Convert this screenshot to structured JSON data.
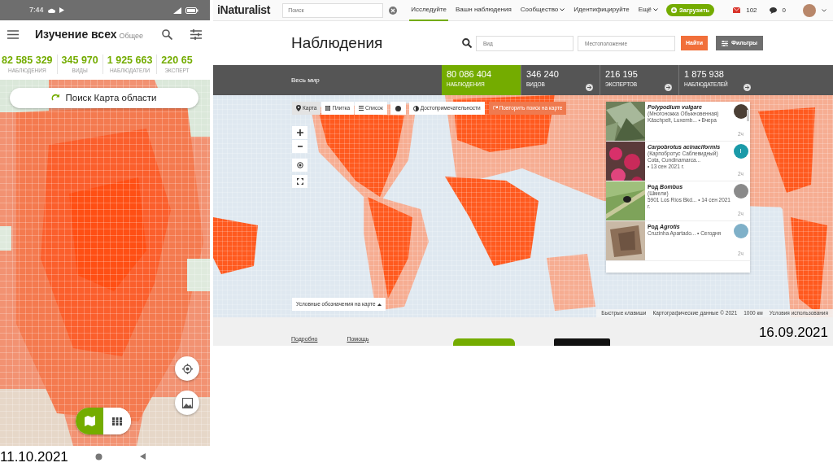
{
  "phone": {
    "status_bar": {
      "time": "7:44"
    },
    "app_bar": {
      "title": "Изучение всех",
      "subtitle": "Общее"
    },
    "stats": [
      {
        "value": "82 585 329",
        "label": "НАБЛЮДЕНИЯ"
      },
      {
        "value": "345 970",
        "label": "ВИДЫ"
      },
      {
        "value": "1 925 663",
        "label": "НАБЛЮДАТЕЛИ"
      },
      {
        "value": "220 65",
        "label": "ЭКСПЕРТ"
      }
    ],
    "search_button": "Поиск Карта области",
    "view_toggle": [
      {
        "kind": "map",
        "selected": true
      },
      {
        "kind": "grid",
        "selected": false
      }
    ],
    "caption": "11.10.2021"
  },
  "web": {
    "navbar": {
      "logo": "iNaturalist",
      "search": {
        "placeholder": "Поиск"
      },
      "links": [
        {
          "label": "Исследуйте",
          "selected": true,
          "dropdown": false
        },
        {
          "label": "Вашн наблюдения",
          "selected": false,
          "dropdown": false
        },
        {
          "label": "Сообщество",
          "selected": false,
          "dropdown": true
        },
        {
          "label": "Идентифицируйте",
          "selected": false,
          "dropdown": false
        },
        {
          "label": "Ещё",
          "selected": false,
          "dropdown": true
        }
      ],
      "upload_button": "Загрузить",
      "messages": "102",
      "notifications": "0"
    },
    "header": {
      "title": "Наблюдения",
      "taxon_field": {
        "placeholder": "Вид"
      },
      "place_field": {
        "placeholder": "Местоположение"
      },
      "search_button": "Найти",
      "filters_button": "Фильтры"
    },
    "stats_bar": {
      "place": "Весь мир",
      "stats": [
        {
          "value": "80 086 404",
          "label": "НАБЛЮДЕНИЯ",
          "selected": true
        },
        {
          "value": "346 240",
          "label": "ВИДОВ",
          "selected": false
        },
        {
          "value": "216 195",
          "label": "ЭКСПЕРТОВ",
          "selected": false
        },
        {
          "value": "1 875 938",
          "label": "НАБЛЮДАТЕЛЕЙ",
          "selected": false
        }
      ]
    },
    "map_toolbar": [
      {
        "kind": "tab",
        "label": "Карта",
        "selected": true
      },
      {
        "kind": "tab",
        "label": "Плитка",
        "selected": false
      },
      {
        "kind": "tab",
        "label": "Список",
        "selected": false
      },
      {
        "kind": "layers"
      },
      {
        "kind": "toggle",
        "label": "Достопримечательности"
      },
      {
        "kind": "action",
        "label": "Повторить поиск на карте"
      }
    ],
    "legend_button": "Условные обозначения на карте",
    "observations": [
      {
        "name": "Polypodium vulgare",
        "common": "(Многоножка Обыкновенная)",
        "meta": [
          "Käschpelt, Luxemb... • Вчера"
        ],
        "time": "2ч",
        "color": "#4a3f35"
      },
      {
        "name": "Carpobrotus acinaciformis",
        "common": "(Карпобротус Саблевидный)",
        "meta": [
          "Cota, Cundinamarca...",
          "• 13 сен 2021 г."
        ],
        "time": "2ч",
        "color": "#1a9aa8",
        "letter": "I"
      },
      {
        "rank": "Род",
        "name": "Bombus",
        "common": "(Шмели)",
        "meta": [
          "5901 Los Ríos Bkd... • 14 сен 2021 г."
        ],
        "time": "2ч",
        "color": "#8a8a8a"
      },
      {
        "rank": "Род",
        "name": "Agrotis",
        "meta": [
          "Cruzinha Apartado... • Сегодня"
        ],
        "time": "2ч",
        "color": "#7fb0c8"
      }
    ],
    "map_footer": [
      "Быстрые клавиши",
      "Картографические данные © 2021",
      "1000 км",
      "Условия использования"
    ],
    "footer_links": [
      "Подробно",
      "Помощь"
    ],
    "caption": "16.09.2021"
  }
}
